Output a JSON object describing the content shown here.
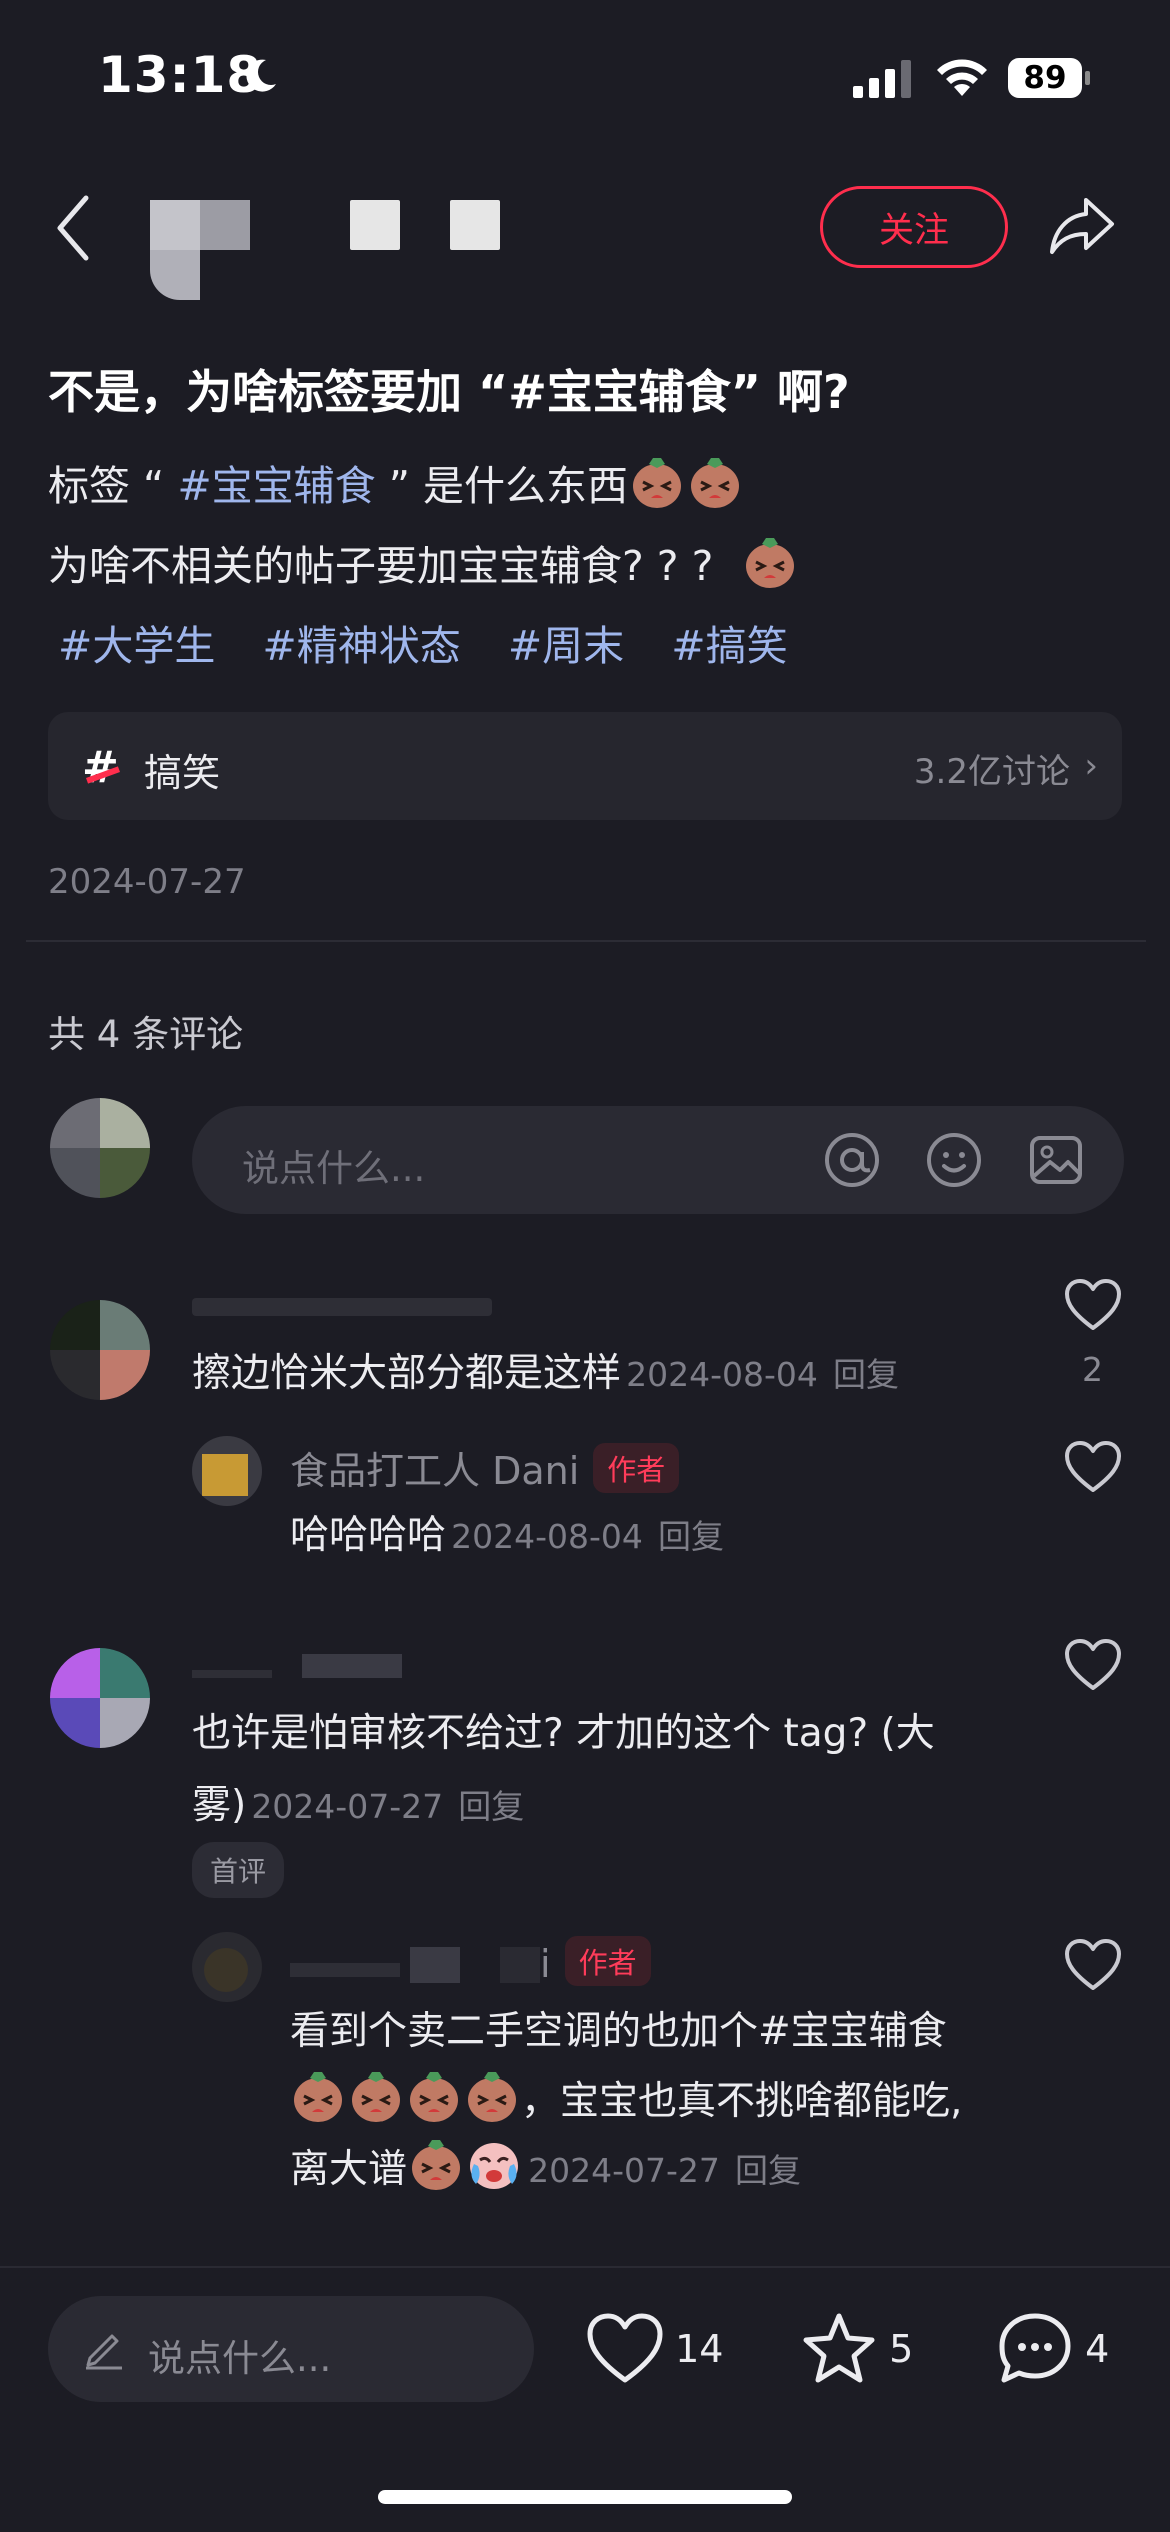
{
  "status_bar": {
    "time": "13:18",
    "battery": "89"
  },
  "header": {
    "follow_label": "关注"
  },
  "post": {
    "title": "不是，为啥标签要加 “#宝宝辅食” 啊?",
    "line1_prefix": "标签 “ ",
    "line1_tag": "#宝宝辅食",
    "line1_suffix": " ” 是什么东西",
    "line2": "为啥不相关的帖子要加宝宝辅食? ? ?",
    "tags": [
      "#大学生",
      "#精神状态",
      "#周末",
      "#搞笑"
    ],
    "topic": {
      "label": "搞笑",
      "count": "3.2亿讨论"
    },
    "date": "2024-07-27"
  },
  "comments_section": {
    "count_label": "共 4 条评论",
    "input_placeholder": "说点什么...",
    "reply_label": "回复",
    "author_badge": "作者",
    "first_badge": "首评",
    "comments": [
      {
        "text": "擦边恰米大部分都是这样",
        "date": "2024-08-04",
        "likes": "2",
        "reply": {
          "name": "食品打工人 Dani",
          "text": "哈哈哈哈",
          "date": "2024-08-04"
        }
      },
      {
        "text_line1": "也许是怕审核不给过? 才加的这个 tag? (大",
        "text_line2": "雾)",
        "date": "2024-07-27",
        "reply": {
          "name_tail": "i",
          "text_line1": "看到个卖二手空调的也加个#宝宝辅食",
          "text_line2_suffix": "，宝宝也真不挑啥都能吃,",
          "text_line3_prefix": "离大谱",
          "date": "2024-07-27"
        }
      }
    ]
  },
  "bottom_bar": {
    "input_placeholder": "说点什么...",
    "likes": "14",
    "stars": "5",
    "comments": "4"
  },
  "colors": {
    "background": "#1c1c24",
    "accent_red": "#ff2e4d",
    "hashtag_blue": "#9fb6ec"
  }
}
